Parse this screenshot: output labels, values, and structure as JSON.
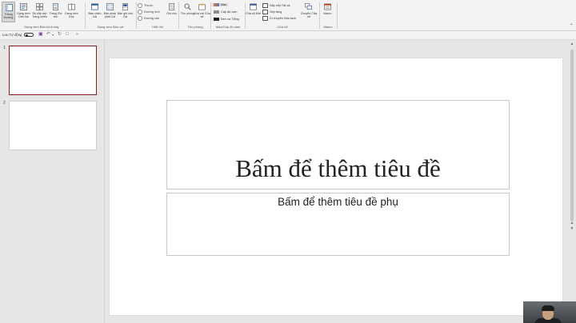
{
  "ribbon": {
    "groups": {
      "presentation_views": {
        "label": "Dạng xem Bản trình bày",
        "buttons": [
          {
            "label": "Thông thường",
            "icon": "normal-view-icon",
            "active": true
          },
          {
            "label": "Dạng xem Dàn bài",
            "icon": "outline-view-icon"
          },
          {
            "label": "Bộ sắp xếp Trang chiếu",
            "icon": "slide-sorter-icon"
          },
          {
            "label": "Trang Ghi chú",
            "icon": "notes-page-icon"
          },
          {
            "label": "Dạng xem Đọc",
            "icon": "reading-view-icon"
          }
        ]
      },
      "master_views": {
        "label": "Dạng xem Bản cái",
        "buttons": [
          {
            "label": "Bản chiếu Cái",
            "icon": "slide-master-icon"
          },
          {
            "label": "Bản phân phát Cái",
            "icon": "handout-master-icon"
          },
          {
            "label": "Bản ghi chú Cái",
            "icon": "notes-master-icon"
          }
        ]
      },
      "show": {
        "label": "Hiển thị",
        "checks": [
          "Thước",
          "Đường lưới",
          "Đường căn"
        ],
        "notes_button": "Ghi chú"
      },
      "zoom": {
        "label": "Thu phóng",
        "buttons": [
          {
            "label": "Thu phóng",
            "icon": "zoom-icon"
          },
          {
            "label": "Vừa với Cửa sổ",
            "icon": "fit-to-window-icon"
          }
        ]
      },
      "color": {
        "label": "Màu/Cấp độ xám",
        "items": [
          {
            "label": "Màu",
            "swatch": "#e07b39"
          },
          {
            "label": "Cấp độ xám",
            "swatch": "#8a8a8a"
          },
          {
            "label": "Đen và Trắng",
            "swatch": "#222222"
          }
        ]
      },
      "window": {
        "label": "Cửa sổ",
        "new_window": "Cửa sổ Mới",
        "items": [
          "Sắp xếp Tất cả",
          "Xếp tầng",
          "Di chuyển Dấu tách"
        ],
        "switch_windows": "Chuyển Cửa sổ"
      },
      "macros": {
        "label": "Macro",
        "button": "Macro"
      }
    }
  },
  "qat": {
    "autosave_label": "Lưu Tự động"
  },
  "thumbnails": [
    {
      "number": "1",
      "selected": true
    },
    {
      "number": "2",
      "selected": false
    }
  ],
  "slide": {
    "title_placeholder": "Bấm để thêm tiêu đề",
    "subtitle_placeholder": "Bấm để thêm tiêu đề phụ"
  },
  "colors": {
    "ribbon_bg": "#f3f3f3",
    "selected_thumb_border": "#8b1d1d",
    "accent": "#c43e1c"
  }
}
